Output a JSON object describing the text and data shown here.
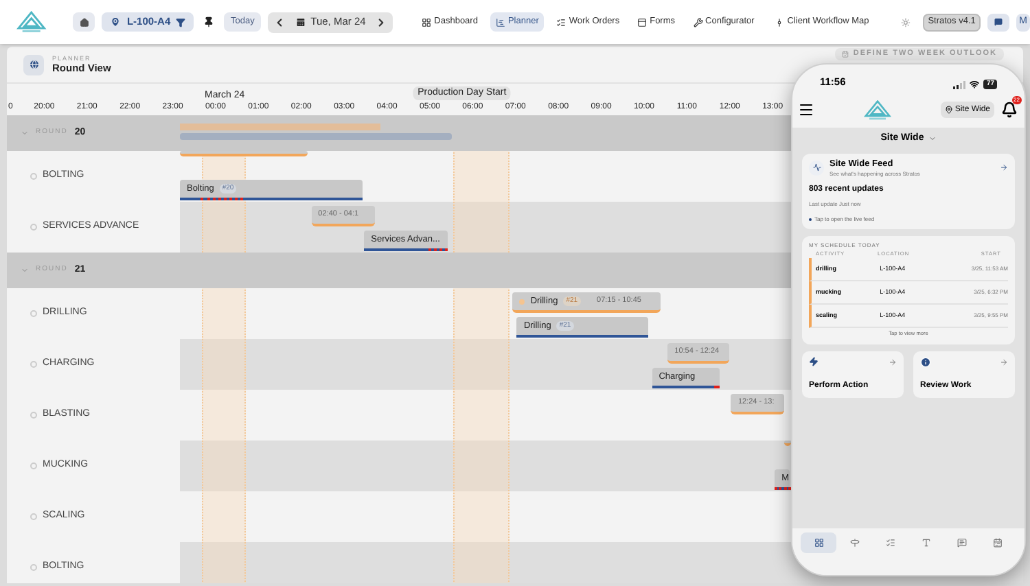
{
  "nav": {
    "location": "L-100-A4",
    "today": "Today",
    "date": "Tue, Mar 24",
    "items": [
      {
        "label": "Dashboard",
        "selected": false
      },
      {
        "label": "Planner",
        "selected": true
      },
      {
        "label": "Work Orders",
        "selected": false
      },
      {
        "label": "Forms",
        "selected": false
      },
      {
        "label": "Configurator",
        "selected": false
      },
      {
        "label": "Client Workflow Map",
        "selected": false
      }
    ],
    "version": "Stratos v4.1",
    "avatar": "M"
  },
  "planner": {
    "eyebrow": "PLANNER",
    "title": "Round View",
    "outlook_button": "DEFINE TWO WEEK OUTLOOK",
    "date_label": "March 24",
    "marker_label": "Production Day Start",
    "hours": [
      "0",
      "20:00",
      "21:00",
      "22:00",
      "23:00",
      "00:00",
      "01:00",
      "02:00",
      "03:00",
      "04:00",
      "05:00",
      "06:00",
      "07:00",
      "08:00",
      "09:00",
      "10:00",
      "11:00",
      "12:00",
      "13:00"
    ]
  },
  "rounds": [
    {
      "label": "ROUND",
      "number": "20",
      "expanded": true,
      "activities": [
        {
          "name": "BOLTING",
          "bars": [
            {
              "kind": "planned"
            },
            {
              "kind": "actual",
              "label": "Bolting",
              "tag": "#20",
              "overdue": true
            }
          ]
        },
        {
          "name": "SERVICES ADVANCE",
          "bars": [
            {
              "kind": "planned",
              "time": "02:40 - 04:1"
            },
            {
              "kind": "actual",
              "label": "Services Advan...",
              "overdue": true
            }
          ]
        }
      ]
    },
    {
      "label": "ROUND",
      "number": "21",
      "expanded": true,
      "activities": [
        {
          "name": "DRILLING",
          "bars": [
            {
              "kind": "planned",
              "label": "Drilling",
              "tag": "#21",
              "time": "07:15 - 10:45"
            },
            {
              "kind": "actual",
              "label": "Drilling",
              "tag": "#21",
              "overdue": false
            }
          ]
        },
        {
          "name": "CHARGING",
          "bars": [
            {
              "kind": "planned",
              "time": "10:54 - 12:24"
            },
            {
              "kind": "actual",
              "label": "Charging",
              "overdue": true
            }
          ]
        },
        {
          "name": "BLASTING",
          "bars": [
            {
              "kind": "planned",
              "time": "12:24 - 13:"
            }
          ]
        },
        {
          "name": "MUCKING",
          "bars": [
            {
              "kind": "planned"
            },
            {
              "kind": "actual",
              "label": "M",
              "overdue": true
            }
          ]
        },
        {
          "name": "SCALING"
        },
        {
          "name": "BOLTING"
        }
      ]
    }
  ],
  "phone": {
    "time": "11:56",
    "battery": "77",
    "location": "Site Wide",
    "badge": "22",
    "scope": "Site Wide",
    "feed": {
      "title": "Site Wide Feed",
      "subtitle": "See what's happening across Stratos",
      "count": "803 recent updates",
      "updated": "Last update Just now",
      "hint": "Tap to open the live feed"
    },
    "schedule": {
      "title": "MY SCHEDULE TODAY",
      "columns": [
        "ACTIVITY",
        "LOCATION",
        "START"
      ],
      "rows": [
        {
          "activity": "drilling",
          "location": "L-100-A4",
          "start": "3/25, 11:53 AM"
        },
        {
          "activity": "mucking",
          "location": "L-100-A4",
          "start": "3/25, 6:32 PM"
        },
        {
          "activity": "scaling",
          "location": "L-100-A4",
          "start": "3/25, 9:55 PM"
        }
      ],
      "more": "Tap to view more"
    },
    "actions": [
      "Perform Action",
      "Review Work"
    ],
    "tabs": [
      {
        "selected": true
      },
      {
        "selected": false
      },
      {
        "selected": false
      },
      {
        "selected": false
      },
      {
        "selected": false
      },
      {
        "selected": false
      }
    ]
  }
}
